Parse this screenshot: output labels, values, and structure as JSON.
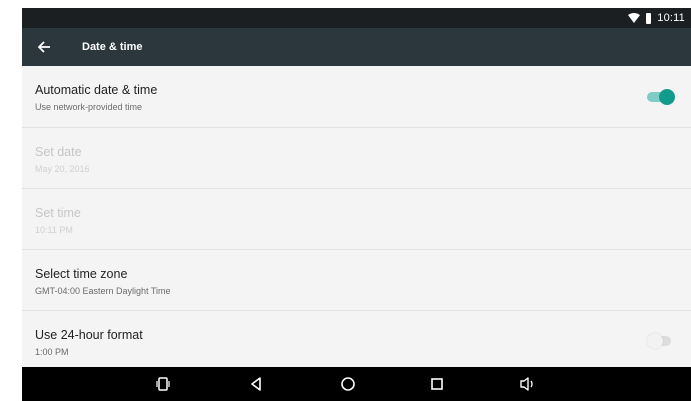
{
  "status_bar": {
    "time": "10:11",
    "icons": [
      "wifi-icon",
      "battery-icon"
    ]
  },
  "toolbar": {
    "title": "Date & time",
    "back_icon": "arrow-back-icon",
    "color": "#2b373c"
  },
  "settings": [
    {
      "title": "Automatic date & time",
      "summary": "Use network-provided time",
      "enabled": true,
      "switch": "on"
    },
    {
      "title": "Set date",
      "summary": "May 20, 2016",
      "enabled": false
    },
    {
      "title": "Set time",
      "summary": "10:11 PM",
      "enabled": false
    },
    {
      "title": "Select time zone",
      "summary": "GMT-04:00 Eastern Daylight Time",
      "enabled": true
    },
    {
      "title": "Use 24-hour format",
      "summary": "1:00 PM",
      "enabled": true,
      "switch": "off"
    }
  ],
  "nav_bar": {
    "icons": [
      "rotate-icon",
      "back-triangle-icon",
      "home-circle-icon",
      "recents-square-icon",
      "volume-icon"
    ]
  },
  "colors": {
    "accent": "#119b8c",
    "toolbar": "#2b373c",
    "status_bar": "#1c1f21"
  }
}
